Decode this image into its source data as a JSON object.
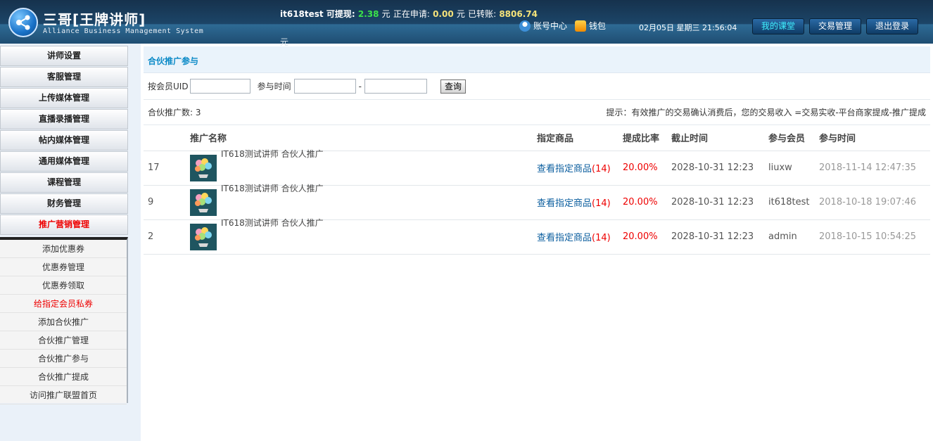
{
  "header": {
    "title": "三哥[王牌讲师]",
    "subtitle": "Alliance Business Management System",
    "balance": {
      "user": "it618test",
      "withdrawable_label": "可提现:",
      "withdrawable": "2.38",
      "yuan1": "元",
      "applying_label": "正在申请:",
      "applying": "0.00",
      "yuan2": "元",
      "transferred_label": "已转账:",
      "transferred": "8806.74",
      "yuan3": "元"
    },
    "account_center": "账号中心",
    "wallet": "钱包",
    "datetime": "02月05日 星期三 21:56:04",
    "buttons": {
      "my_class": "我的课堂",
      "trade": "交易管理",
      "logout": "退出登录"
    },
    "colors": {
      "accent_active": "#3ff0ff",
      "amount_green": "#3be34a",
      "amount_yellow": "#f5e37a"
    }
  },
  "sidebar": {
    "items": [
      {
        "label": "讲师设置"
      },
      {
        "label": "客服管理"
      },
      {
        "label": "上传媒体管理"
      },
      {
        "label": "直播录播管理"
      },
      {
        "label": "帖内媒体管理"
      },
      {
        "label": "通用媒体管理"
      },
      {
        "label": "课程管理"
      },
      {
        "label": "财务管理"
      },
      {
        "label": "推广营销管理"
      }
    ],
    "subitems": [
      {
        "label": "添加优惠券"
      },
      {
        "label": "优惠券管理"
      },
      {
        "label": "优惠券领取"
      },
      {
        "label": "给指定会员私券"
      },
      {
        "label": "添加合伙推广"
      },
      {
        "label": "合伙推广管理"
      },
      {
        "label": "合伙推广参与"
      },
      {
        "label": "合伙推广提成"
      },
      {
        "label": "访问推广联盟首页"
      }
    ]
  },
  "main": {
    "page_title": "合伙推广参与",
    "filter": {
      "uid_label": "按会员UID",
      "uid_value": "",
      "time_label": "参与时间",
      "time_from": "",
      "dash": "-",
      "time_to": "",
      "query_button": "查询"
    },
    "count_label": "合伙推广数:",
    "count": "3",
    "tip": "提示：有效推广的交易确认消费后，您的交易收入 =交易实收-平台商家提成-推广提成",
    "table": {
      "headers": [
        "",
        "推广名称",
        "指定商品",
        "提成比率",
        "截止时间",
        "参与会员",
        "参与时间"
      ],
      "rows": [
        {
          "id": "17",
          "name": "IT618测试讲师 合伙人推广",
          "link_text": "查看指定商品",
          "link_count": "14",
          "rate": "20.00%",
          "deadline": "2028-10-31 12:23",
          "member": "liuxw",
          "join_time": "2018-11-14 12:47:35"
        },
        {
          "id": "9",
          "name": "IT618测试讲师 合伙人推广",
          "link_text": "查看指定商品",
          "link_count": "14",
          "rate": "20.00%",
          "deadline": "2028-10-31 12:23",
          "member": "it618test",
          "join_time": "2018-10-18 19:07:46"
        },
        {
          "id": "2",
          "name": "IT618测试讲师 合伙人推广",
          "link_text": "查看指定商品",
          "link_count": "14",
          "rate": "20.00%",
          "deadline": "2028-10-31 12:23",
          "member": "admin",
          "join_time": "2018-10-15 10:54:25"
        }
      ]
    }
  }
}
